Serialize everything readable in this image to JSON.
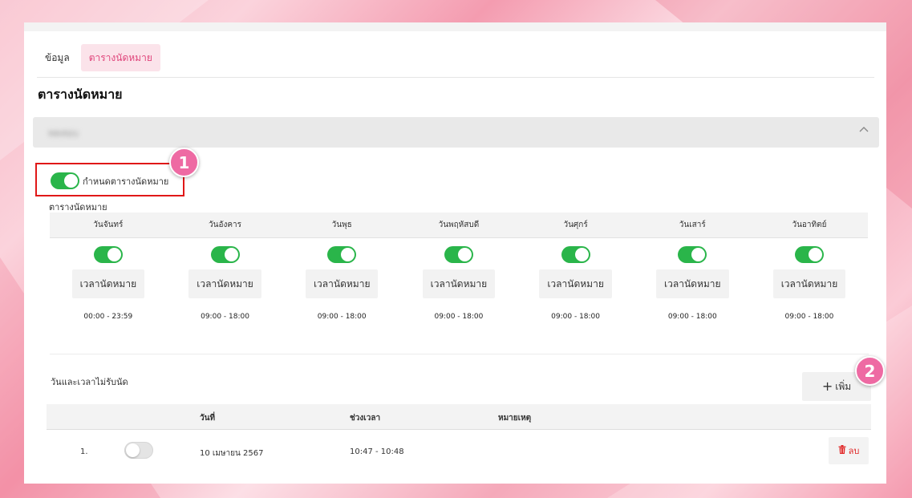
{
  "tabs": [
    {
      "label": "ข้อมูล",
      "active": false
    },
    {
      "label": "ตารางนัดหมาย",
      "active": true
    }
  ],
  "page_title": "ตารางนัดหมาย",
  "accordion": {
    "label": "ทดสอบ",
    "state": "expanded",
    "icon": "chevron-up-icon"
  },
  "schedule_toggle": {
    "label": "กำหนดตารางนัดหมาย",
    "on": true
  },
  "schedule_label": "ตารางนัดหมาย",
  "days": [
    {
      "name": "วันจันทร์",
      "enabled": true,
      "button_label": "เวลานัดหมาย",
      "time_range": "00:00 - 23:59"
    },
    {
      "name": "วันอังคาร",
      "enabled": true,
      "button_label": "เวลานัดหมาย",
      "time_range": "09:00 - 18:00"
    },
    {
      "name": "วันพุธ",
      "enabled": true,
      "button_label": "เวลานัดหมาย",
      "time_range": "09:00 - 18:00"
    },
    {
      "name": "วันพฤหัสบดี",
      "enabled": true,
      "button_label": "เวลานัดหมาย",
      "time_range": "09:00 - 18:00"
    },
    {
      "name": "วันศุกร์",
      "enabled": true,
      "button_label": "เวลานัดหมาย",
      "time_range": "09:00 - 18:00"
    },
    {
      "name": "วันเสาร์",
      "enabled": true,
      "button_label": "เวลานัดหมาย",
      "time_range": "09:00 - 18:00"
    },
    {
      "name": "วันอาทิตย์",
      "enabled": true,
      "button_label": "เวลานัดหมาย",
      "time_range": "09:00 - 18:00"
    }
  ],
  "holidays": {
    "label": "วันและเวลาไม่รับนัด",
    "add_button": "เพิ่ม",
    "columns": [
      "วันที่",
      "ช่วงเวลา",
      "หมายเหตุ"
    ],
    "rows": [
      {
        "index": "1.",
        "enabled": false,
        "date": "10 เมษายน 2567",
        "time": "10:47 - 10:48",
        "note": "",
        "delete_label": "ลบ"
      }
    ]
  },
  "annotations": {
    "badge_1": "1",
    "badge_2": "2"
  },
  "colors": {
    "accent": "#e0457b",
    "toggle_on": "#2ab54a",
    "highlight": "#e01818",
    "badge": "#ee6aa3",
    "delete": "#e02828"
  }
}
